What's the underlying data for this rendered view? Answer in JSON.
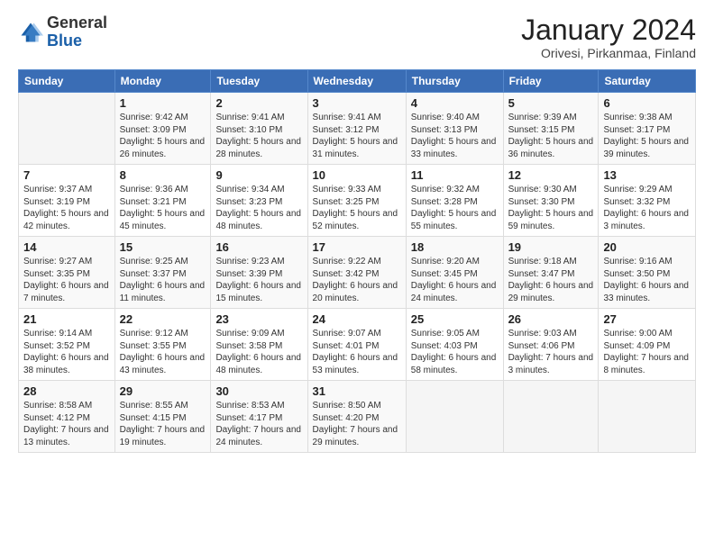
{
  "logo": {
    "general": "General",
    "blue": "Blue"
  },
  "header": {
    "month": "January 2024",
    "location": "Orivesi, Pirkanmaa, Finland"
  },
  "columns": [
    "Sunday",
    "Monday",
    "Tuesday",
    "Wednesday",
    "Thursday",
    "Friday",
    "Saturday"
  ],
  "weeks": [
    [
      {
        "day": "",
        "info": ""
      },
      {
        "day": "1",
        "info": "Sunrise: 9:42 AM\nSunset: 3:09 PM\nDaylight: 5 hours\nand 26 minutes."
      },
      {
        "day": "2",
        "info": "Sunrise: 9:41 AM\nSunset: 3:10 PM\nDaylight: 5 hours\nand 28 minutes."
      },
      {
        "day": "3",
        "info": "Sunrise: 9:41 AM\nSunset: 3:12 PM\nDaylight: 5 hours\nand 31 minutes."
      },
      {
        "day": "4",
        "info": "Sunrise: 9:40 AM\nSunset: 3:13 PM\nDaylight: 5 hours\nand 33 minutes."
      },
      {
        "day": "5",
        "info": "Sunrise: 9:39 AM\nSunset: 3:15 PM\nDaylight: 5 hours\nand 36 minutes."
      },
      {
        "day": "6",
        "info": "Sunrise: 9:38 AM\nSunset: 3:17 PM\nDaylight: 5 hours\nand 39 minutes."
      }
    ],
    [
      {
        "day": "7",
        "info": "Sunrise: 9:37 AM\nSunset: 3:19 PM\nDaylight: 5 hours\nand 42 minutes."
      },
      {
        "day": "8",
        "info": "Sunrise: 9:36 AM\nSunset: 3:21 PM\nDaylight: 5 hours\nand 45 minutes."
      },
      {
        "day": "9",
        "info": "Sunrise: 9:34 AM\nSunset: 3:23 PM\nDaylight: 5 hours\nand 48 minutes."
      },
      {
        "day": "10",
        "info": "Sunrise: 9:33 AM\nSunset: 3:25 PM\nDaylight: 5 hours\nand 52 minutes."
      },
      {
        "day": "11",
        "info": "Sunrise: 9:32 AM\nSunset: 3:28 PM\nDaylight: 5 hours\nand 55 minutes."
      },
      {
        "day": "12",
        "info": "Sunrise: 9:30 AM\nSunset: 3:30 PM\nDaylight: 5 hours\nand 59 minutes."
      },
      {
        "day": "13",
        "info": "Sunrise: 9:29 AM\nSunset: 3:32 PM\nDaylight: 6 hours\nand 3 minutes."
      }
    ],
    [
      {
        "day": "14",
        "info": "Sunrise: 9:27 AM\nSunset: 3:35 PM\nDaylight: 6 hours\nand 7 minutes."
      },
      {
        "day": "15",
        "info": "Sunrise: 9:25 AM\nSunset: 3:37 PM\nDaylight: 6 hours\nand 11 minutes."
      },
      {
        "day": "16",
        "info": "Sunrise: 9:23 AM\nSunset: 3:39 PM\nDaylight: 6 hours\nand 15 minutes."
      },
      {
        "day": "17",
        "info": "Sunrise: 9:22 AM\nSunset: 3:42 PM\nDaylight: 6 hours\nand 20 minutes."
      },
      {
        "day": "18",
        "info": "Sunrise: 9:20 AM\nSunset: 3:45 PM\nDaylight: 6 hours\nand 24 minutes."
      },
      {
        "day": "19",
        "info": "Sunrise: 9:18 AM\nSunset: 3:47 PM\nDaylight: 6 hours\nand 29 minutes."
      },
      {
        "day": "20",
        "info": "Sunrise: 9:16 AM\nSunset: 3:50 PM\nDaylight: 6 hours\nand 33 minutes."
      }
    ],
    [
      {
        "day": "21",
        "info": "Sunrise: 9:14 AM\nSunset: 3:52 PM\nDaylight: 6 hours\nand 38 minutes."
      },
      {
        "day": "22",
        "info": "Sunrise: 9:12 AM\nSunset: 3:55 PM\nDaylight: 6 hours\nand 43 minutes."
      },
      {
        "day": "23",
        "info": "Sunrise: 9:09 AM\nSunset: 3:58 PM\nDaylight: 6 hours\nand 48 minutes."
      },
      {
        "day": "24",
        "info": "Sunrise: 9:07 AM\nSunset: 4:01 PM\nDaylight: 6 hours\nand 53 minutes."
      },
      {
        "day": "25",
        "info": "Sunrise: 9:05 AM\nSunset: 4:03 PM\nDaylight: 6 hours\nand 58 minutes."
      },
      {
        "day": "26",
        "info": "Sunrise: 9:03 AM\nSunset: 4:06 PM\nDaylight: 7 hours\nand 3 minutes."
      },
      {
        "day": "27",
        "info": "Sunrise: 9:00 AM\nSunset: 4:09 PM\nDaylight: 7 hours\nand 8 minutes."
      }
    ],
    [
      {
        "day": "28",
        "info": "Sunrise: 8:58 AM\nSunset: 4:12 PM\nDaylight: 7 hours\nand 13 minutes."
      },
      {
        "day": "29",
        "info": "Sunrise: 8:55 AM\nSunset: 4:15 PM\nDaylight: 7 hours\nand 19 minutes."
      },
      {
        "day": "30",
        "info": "Sunrise: 8:53 AM\nSunset: 4:17 PM\nDaylight: 7 hours\nand 24 minutes."
      },
      {
        "day": "31",
        "info": "Sunrise: 8:50 AM\nSunset: 4:20 PM\nDaylight: 7 hours\nand 29 minutes."
      },
      {
        "day": "",
        "info": ""
      },
      {
        "day": "",
        "info": ""
      },
      {
        "day": "",
        "info": ""
      }
    ]
  ]
}
